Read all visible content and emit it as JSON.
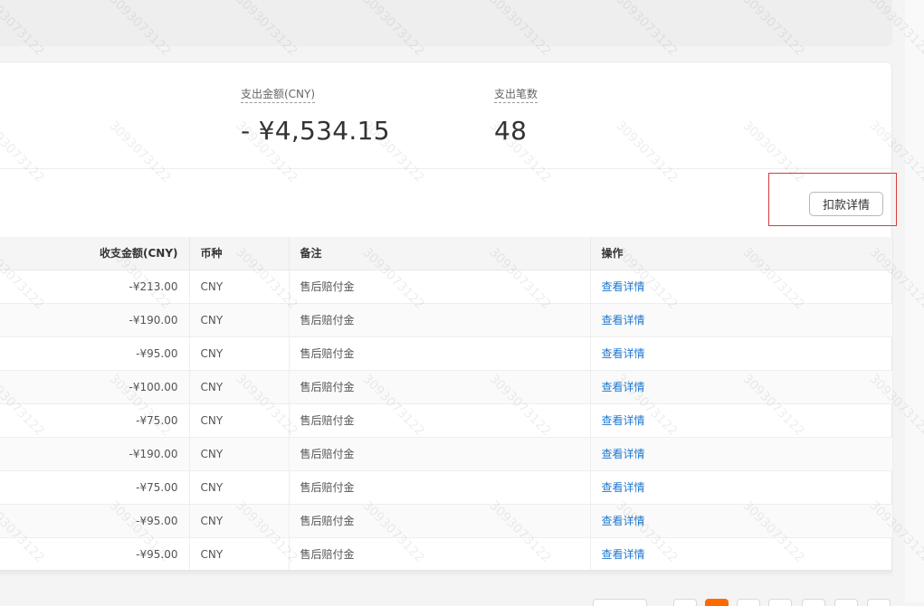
{
  "summary": {
    "expense_amount_label": "支出金额(CNY)",
    "expense_amount_value": "- ¥4,534.15",
    "expense_count_label": "支出笔数",
    "expense_count_value": "48"
  },
  "toolbar": {
    "detail_button_label": "扣款详情"
  },
  "table": {
    "headers": {
      "amount": "收支金额(CNY)",
      "currency": "币种",
      "remark": "备注",
      "action": "操作"
    },
    "rows": [
      {
        "amount": "-¥213.00",
        "currency": "CNY",
        "remark": "售后赔付金",
        "action": "查看详情"
      },
      {
        "amount": "-¥190.00",
        "currency": "CNY",
        "remark": "售后赔付金",
        "action": "查看详情"
      },
      {
        "amount": "-¥95.00",
        "currency": "CNY",
        "remark": "售后赔付金",
        "action": "查看详情"
      },
      {
        "amount": "-¥100.00",
        "currency": "CNY",
        "remark": "售后赔付金",
        "action": "查看详情"
      },
      {
        "amount": "-¥75.00",
        "currency": "CNY",
        "remark": "售后赔付金",
        "action": "查看详情"
      },
      {
        "amount": "-¥190.00",
        "currency": "CNY",
        "remark": "售后赔付金",
        "action": "查看详情"
      },
      {
        "amount": "-¥75.00",
        "currency": "CNY",
        "remark": "售后赔付金",
        "action": "查看详情"
      },
      {
        "amount": "-¥95.00",
        "currency": "CNY",
        "remark": "售后赔付金",
        "action": "查看详情"
      },
      {
        "amount": "-¥95.00",
        "currency": "CNY",
        "remark": "售后赔付金",
        "action": "查看详情"
      }
    ]
  },
  "watermark": {
    "text": "3093073122"
  },
  "colors": {
    "link": "#1e78d2",
    "highlight_border": "#d93b3b",
    "pager_active": "#ff6a00"
  }
}
